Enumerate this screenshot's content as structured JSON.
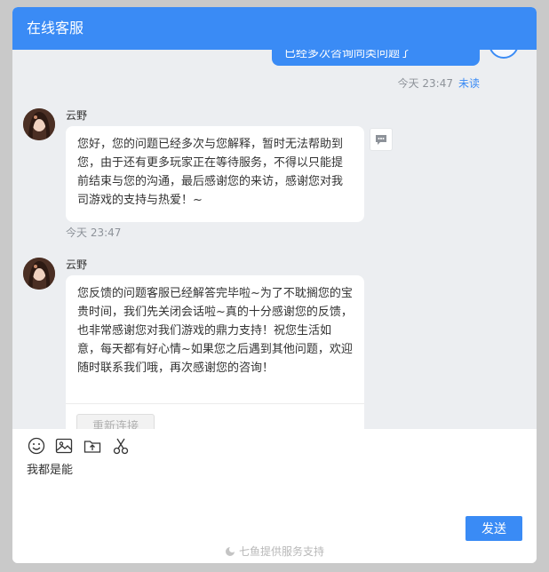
{
  "header": {
    "title": "在线客服"
  },
  "sent_message": {
    "text": "已经多次咨询同类问题了",
    "time": "今天 23:47",
    "status": "未读"
  },
  "agent_messages": [
    {
      "agent_name": "云野",
      "text": "您好，您的问题已经多次与您解释，暂时无法帮助到您，由于还有更多玩家正在等待服务，不得以只能提前结束与您的沟通，最后感谢您的来访，感谢您对我司游戏的支持与热爱！~",
      "time": "今天 23:47"
    },
    {
      "agent_name": "云野",
      "text": "您反馈的问题客服已经解答完毕啦~为了不耽搁您的宝贵时间，我们先关闭会话啦~真的十分感谢您的反馈，也非常感谢您对我们游戏的鼎力支持！祝您生活如意，每天都有好心情~如果您之后遇到其他问题，欢迎随时联系我们哦，再次感谢您的咨询！",
      "reconnect_label": "重新连接"
    }
  ],
  "composer": {
    "toolbar": [
      "emoji-icon",
      "image-icon",
      "upload-icon",
      "scissors-icon"
    ],
    "draft_text": "我都是能",
    "send_label": "发送",
    "powered_by": "七鱼提供服务支持"
  },
  "colors": {
    "brand": "#3a8bf5",
    "chat_background": "#eceef1",
    "bubble": "#ffffff"
  }
}
